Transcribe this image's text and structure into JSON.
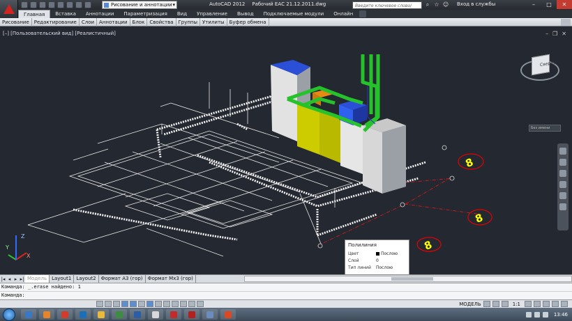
{
  "app": {
    "title": "AutoCAD 2012",
    "file": "Рабочий ЕАС 21.12.2011.dwg",
    "workspace": "Рисование и аннотации",
    "search_placeholder": "Введите ключевое слово/фразу",
    "signin": "Вход в службы",
    "accent_color": "#d2231e"
  },
  "ribbon": {
    "tabs": [
      "Главная",
      "Вставка",
      "Аннотации",
      "Параметризация",
      "Вид",
      "Управление",
      "Вывод",
      "Подключаемые модули",
      "Онлайн"
    ],
    "active_tab": "Главная",
    "panels": [
      "Рисование",
      "Редактирование",
      "Слои",
      "Аннотации",
      "Блок",
      "Свойства",
      "Группы",
      "Утилиты",
      "Буфер обмена"
    ]
  },
  "viewport": {
    "label": "[–] [Пользовательский вид] [Реалистичный]",
    "viewcube_face": "Сверху",
    "wcs_menu": "Без имени",
    "markers": [
      "8",
      "8",
      "8"
    ],
    "marker_color": "#ffff00",
    "marker_ring_color": "#e60000",
    "ucs_axes": [
      "X",
      "Y",
      "Z"
    ]
  },
  "tooltip": {
    "title": "Полилиния",
    "rows": [
      {
        "key": "Цвет",
        "value": "Послою"
      },
      {
        "key": "Слой",
        "value": "0"
      },
      {
        "key": "Тип линий",
        "value": "Послою"
      }
    ]
  },
  "layout_tabs": [
    "Модель",
    "Layout1",
    "Layout2",
    "Формат А3 (гор)",
    "Формат Мх3 (гор)"
  ],
  "active_layout": "Модель",
  "command": {
    "line1": "Команда: _.erase найдено: 1",
    "line2": "Команда:"
  },
  "status": {
    "coords": "",
    "model": "МОДЕЛЬ",
    "scale": "1:1",
    "clock": "13:46"
  },
  "taskbar": {
    "app_colors": [
      "#3a78c4",
      "#e5842a",
      "#d33b2b",
      "#1b6fb8",
      "#e8b93a",
      "#3c8d3f",
      "#2b5ea6",
      "#d8d8d8",
      "#c22b2b",
      "#b32020",
      "#6c8cc0",
      "#d94a24"
    ]
  }
}
